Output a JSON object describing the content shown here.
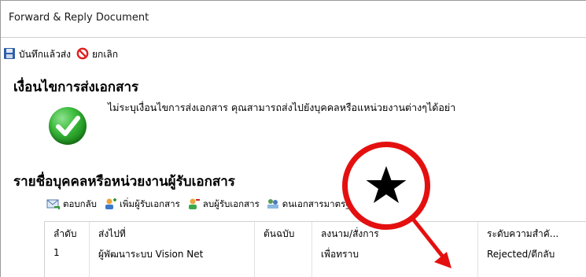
{
  "window": {
    "title": "Forward & Reply Document"
  },
  "toolbar": {
    "save_label": "บันทึกแล้วส่ง",
    "cancel_label": "ยกเลิก"
  },
  "condition": {
    "heading": "เงื่อนไขการส่งเอกสาร",
    "message": "ไม่ระบุเงื่อนไขการส่งเอกสาร คุณสามารถส่งไปยังบุคคลหรือแหน่วยงานต่างๆได้อย่า"
  },
  "recipients": {
    "heading": "รายชื่อบุคคลหรือหน่วยงานผู้รับเอกสาร",
    "toolbar": {
      "reply": "ตอบกลับ",
      "add": "เพิ่มผู้รับเอกสาร",
      "remove": "ลบผู้รับเอกสาร",
      "standard": "ดนเอกสารมาตรฐาน"
    },
    "columns": [
      "ลำดับ",
      "ส่งไปที่",
      "ต้นฉบับ",
      "ลงนาม/สั่งการ",
      "ระดับความสำคั..."
    ],
    "rows": [
      [
        "1",
        "ผู้พัฒนาระบบ Vision Net",
        "",
        "เพื่อทราบ",
        "Rejected/ตีกลับ"
      ]
    ]
  },
  "colors": {
    "annotation": "#e41010",
    "check": "#2faa2f"
  },
  "icons": [
    "save-icon",
    "cancel-icon",
    "checkmark-icon",
    "reply-icon",
    "add-user-icon",
    "remove-user-icon",
    "standard-doc-icon",
    "arrow-up-icon",
    "arrow-down-icon",
    "star-icon"
  ]
}
